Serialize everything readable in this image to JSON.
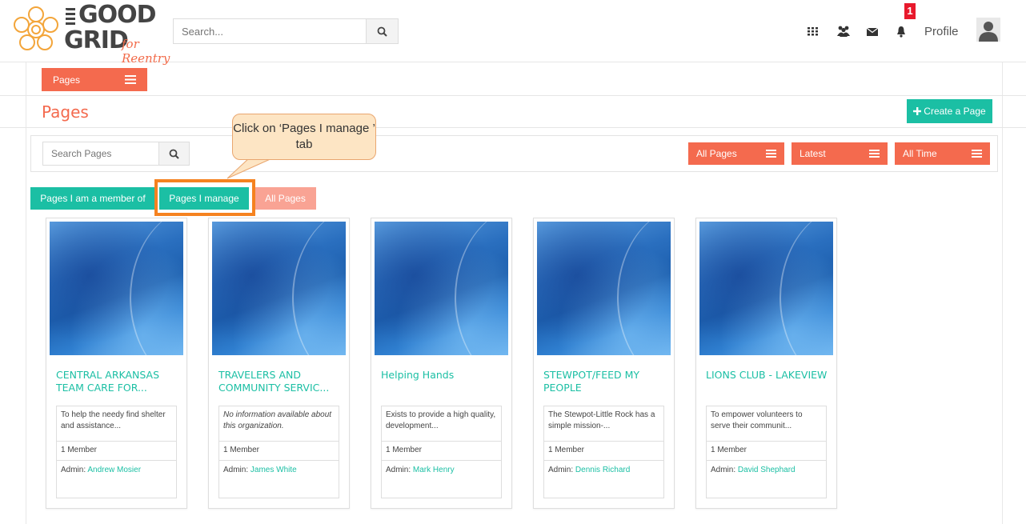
{
  "header": {
    "logo_the": "THE",
    "logo_good": "GOOD",
    "logo_grid": "GRID",
    "logo_tagline": "for Reentry",
    "search_placeholder": "Search...",
    "notification_count": "1",
    "profile_label": "Profile"
  },
  "page": {
    "menu_label": "Pages",
    "title": "Pages",
    "create_label": "Create a Page",
    "search_placeholder": "Search Pages",
    "filters": [
      "All Pages",
      "Latest",
      "All Time"
    ]
  },
  "tabs": {
    "member": "Pages I am a member of",
    "manage": "Pages I manage",
    "all": "All Pages"
  },
  "callout": {
    "text": "Click on ‘Pages I manage ’ tab"
  },
  "cards": [
    {
      "title": "CENTRAL ARKANSAS TEAM CARE FOR...",
      "desc": "To help the needy find shelter and assistance...",
      "members": "1 Member",
      "admin_label": "Admin:",
      "admin": "Andrew Mosier"
    },
    {
      "title": "TRAVELERS AND COMMUNITY SERVIC...",
      "desc": "No information available about this organization.",
      "members": "1 Member",
      "admin_label": "Admin:",
      "admin": "James White"
    },
    {
      "title": "Helping Hands",
      "desc": "Exists to provide a high quality, development...",
      "members": "1 Member",
      "admin_label": "Admin:",
      "admin": "Mark Henry"
    },
    {
      "title": "STEWPOT/FEED MY PEOPLE",
      "desc": "The Stewpot-Little Rock has a simple mission-...",
      "members": "1 Member",
      "admin_label": "Admin:",
      "admin": "Dennis Richard"
    },
    {
      "title": "LIONS CLUB - LAKEVIEW",
      "desc": "To empower volunteers to serve their communit...",
      "members": "1 Member",
      "admin_label": "Admin:",
      "admin": "David Shephard"
    }
  ],
  "colors": {
    "accent_teal": "#1bbfa4",
    "accent_coral": "#f46a4e",
    "highlight_orange": "#f58220",
    "callout_fill": "#fde5c4"
  }
}
